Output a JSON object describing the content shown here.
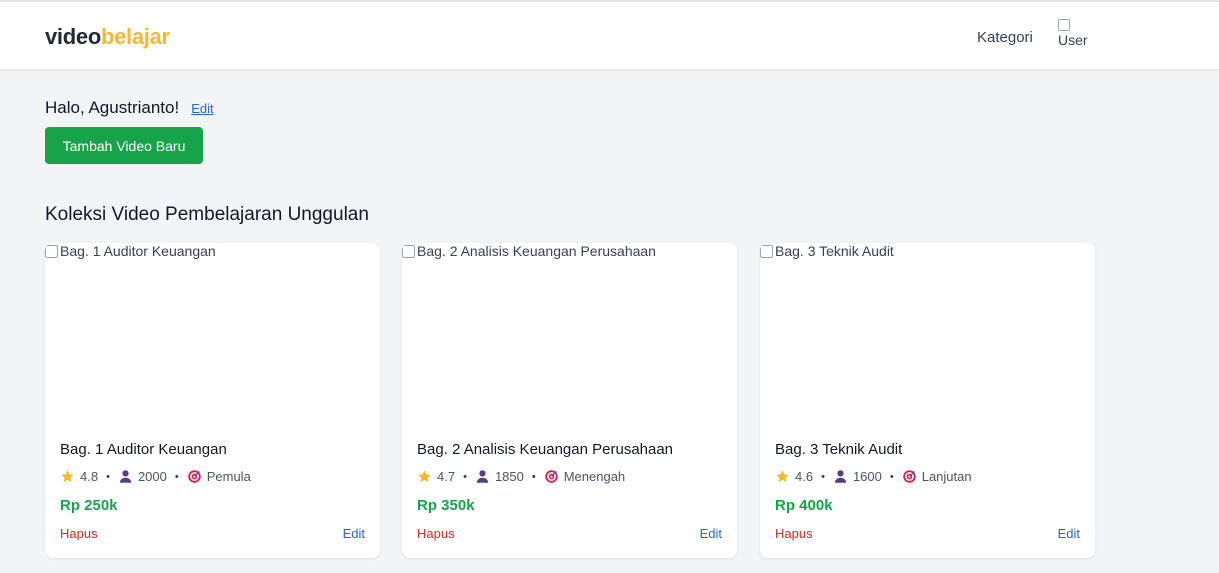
{
  "brand": {
    "part1": "video",
    "part2": "belajar"
  },
  "nav": {
    "kategori": "Kategori",
    "avatar_alt": "User"
  },
  "greeting": {
    "text": "Halo, Agustrianto!",
    "edit": "Edit"
  },
  "add_button": "Tambah Video Baru",
  "section_title": "Koleksi Video Pembelajaran Unggulan",
  "colors": {
    "brand_accent": "#f5b82e",
    "primary_green": "#16a34a",
    "danger": "#dc2626",
    "link": "#2563eb"
  },
  "cards": [
    {
      "image_alt": "Bag. 1 Auditor Keuangan",
      "title": "Bag. 1 Auditor Keuangan",
      "rating": "4.8",
      "students": "2000",
      "level": "Pemula",
      "price": "Rp 250k",
      "delete": "Hapus",
      "edit": "Edit"
    },
    {
      "image_alt": "Bag. 2 Analisis Keuangan Perusahaan",
      "title": "Bag. 2 Analisis Keuangan Perusahaan",
      "rating": "4.7",
      "students": "1850",
      "level": "Menengah",
      "price": "Rp 350k",
      "delete": "Hapus",
      "edit": "Edit"
    },
    {
      "image_alt": "Bag. 3 Teknik Audit",
      "title": "Bag. 3 Teknik Audit",
      "rating": "4.6",
      "students": "1600",
      "level": "Lanjutan",
      "price": "Rp 400k",
      "delete": "Hapus",
      "edit": "Edit"
    }
  ],
  "icons": {
    "rating": "star-icon",
    "students": "user-icon",
    "level": "target-icon"
  }
}
